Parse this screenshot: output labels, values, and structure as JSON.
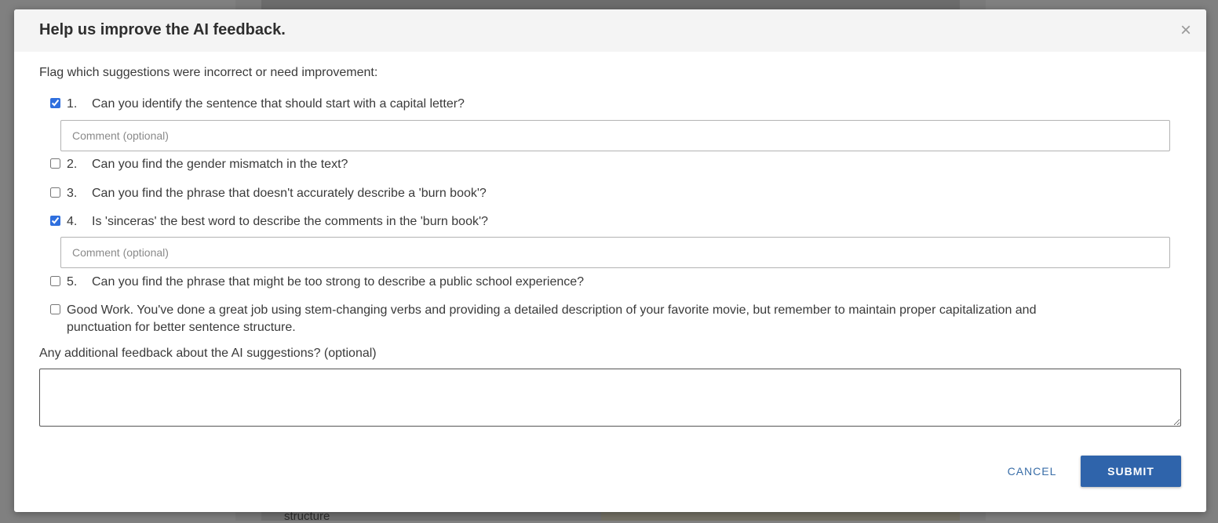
{
  "background": {
    "partial_text": "structure"
  },
  "modal": {
    "title": "Help us improve the AI feedback.",
    "close_label": "×",
    "instruction": "Flag which suggestions were incorrect or need improvement:",
    "items": [
      {
        "number": "1.",
        "text": "Can you identify the sentence that should start with a capital letter?",
        "checked": true
      },
      {
        "number": "2.",
        "text": "Can you find the gender mismatch in the text?",
        "checked": false
      },
      {
        "number": "3.",
        "text": "Can you find the phrase that doesn't accurately describe a 'burn book'?",
        "checked": false
      },
      {
        "number": "4.",
        "text": "Is 'sinceras' the best word to describe the comments in the 'burn book'?",
        "checked": true
      },
      {
        "number": "5.",
        "text": "Can you find the phrase that might be too strong to describe a public school experience?",
        "checked": false
      }
    ],
    "good_work": {
      "text": "Good Work. You've done a great job using stem-changing verbs and providing a detailed description of your favorite movie, but remember to maintain proper capitalization and punctuation for better sentence structure.",
      "checked": false
    },
    "comment_placeholder": "Comment (optional)",
    "comment_values": [
      "",
      ""
    ],
    "additional_label": "Any additional feedback about the AI suggestions? (optional)",
    "additional_value": "",
    "cancel_label": "CANCEL",
    "submit_label": "SUBMIT"
  },
  "colors": {
    "overlay": "#808080",
    "header_bg": "#f4f4f4",
    "checkbox_accent": "#2f6fde",
    "cancel_text": "#3a6ea8",
    "submit_bg": "#2f64ab"
  }
}
